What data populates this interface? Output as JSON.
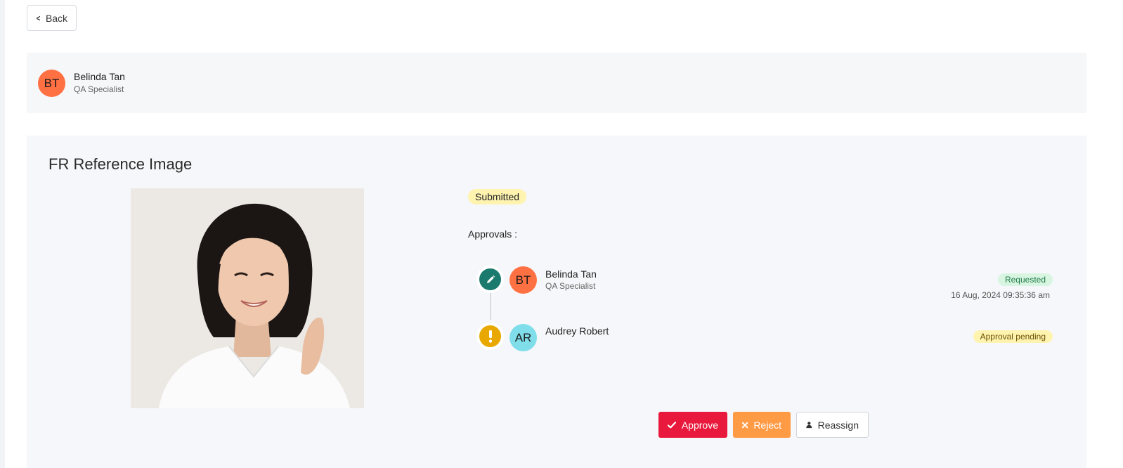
{
  "back_button": {
    "label": "Back",
    "icon": "chevron-left-icon"
  },
  "user": {
    "initials": "BT",
    "name": "Belinda Tan",
    "role": "QA Specialist",
    "avatar_color": "#ff7043"
  },
  "panel": {
    "title": "FR Reference Image",
    "status": "Submitted",
    "approvals_label": "Approvals :",
    "approvals": [
      {
        "initials": "BT",
        "name": "Belinda Tan",
        "role": "QA Specialist",
        "status": "Requested",
        "timestamp": "16 Aug, 2024 09:35:36 am",
        "step_icon": "pencil-icon",
        "avatar_color": "#ff7043"
      },
      {
        "initials": "AR",
        "name": "Audrey Robert",
        "status": "Approval pending",
        "step_icon": "exclamation-icon",
        "avatar_color": "#80deea"
      }
    ],
    "actions": {
      "approve": "Approve",
      "reject": "Reject",
      "reassign": "Reassign"
    }
  },
  "colors": {
    "approve": "#e8193c",
    "reject": "#ff9a45",
    "step_done": "#1b7a6e",
    "step_pending": "#e9a800"
  }
}
